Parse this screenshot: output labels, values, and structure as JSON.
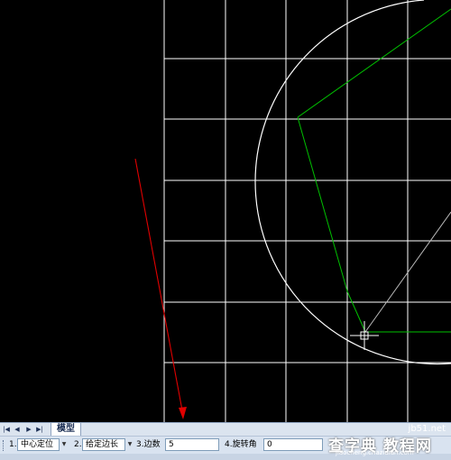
{
  "tabs": {
    "model": "模型"
  },
  "tab_nav": {
    "first": "|◀",
    "prev": "◀",
    "next": "▶",
    "last": "▶|"
  },
  "props": {
    "f1_label": "1.",
    "f1_value": "中心定位",
    "f2_label": "2.",
    "f2_value": "给定边长",
    "f3_label": "3.边数",
    "f3_value": "5",
    "f4_label": "4.旋转角",
    "f4_value": "0"
  },
  "watermark": {
    "site_line": "jb51.net",
    "brand": "查字典 教程网",
    "url_line": "jiaocheng.chazidian.com"
  },
  "colors": {
    "canvas_bg": "#000000",
    "grid": "#ffffff",
    "polygon": "#00c000",
    "arrow": "#e00000"
  }
}
